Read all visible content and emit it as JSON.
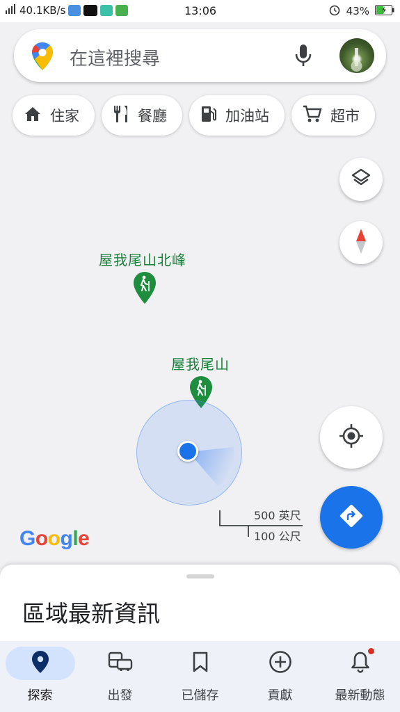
{
  "status_bar": {
    "speed": "40.1KB/s",
    "time": "13:06",
    "battery": "43%",
    "icons": [
      "signal-icon",
      "shield-app-icon",
      "youtube-icon",
      "vpn-icon",
      "android-app-icon",
      "alarm-icon",
      "battery-charging-icon"
    ]
  },
  "search": {
    "placeholder": "在這裡搜尋",
    "icons": [
      "maps-pin-logo-icon",
      "microphone-icon",
      "profile-avatar"
    ]
  },
  "chips": [
    {
      "label": "住家",
      "icon": "home-icon"
    },
    {
      "label": "餐廳",
      "icon": "restaurant-icon"
    },
    {
      "label": "加油站",
      "icon": "gas-station-icon"
    },
    {
      "label": "超市",
      "icon": "shopping-cart-icon"
    }
  ],
  "map": {
    "pois": [
      {
        "label": "屋我尾山北峰",
        "icon": "hiking-icon"
      },
      {
        "label": "屋我尾山",
        "icon": "hiking-icon"
      }
    ],
    "scale": {
      "imperial": "500 英尺",
      "metric": "100 公尺"
    },
    "logo": "Google",
    "controls": [
      "layers-icon",
      "compass-icon",
      "my-location-icon",
      "directions-icon"
    ]
  },
  "sheet": {
    "title": "區域最新資訊"
  },
  "nav": [
    {
      "label": "探索",
      "icon": "explore-pin-icon",
      "active": true
    },
    {
      "label": "出發",
      "icon": "commute-icon"
    },
    {
      "label": "已儲存",
      "icon": "bookmark-icon"
    },
    {
      "label": "貢獻",
      "icon": "add-circle-icon"
    },
    {
      "label": "最新動態",
      "icon": "bell-icon",
      "badge": true
    }
  ],
  "colors": {
    "accent": "#1a73e8",
    "poi_green": "#188038",
    "location_dot": "#1a73e8",
    "nav_bg": "#eef1f8",
    "nav_active": "#d3e3fd"
  }
}
